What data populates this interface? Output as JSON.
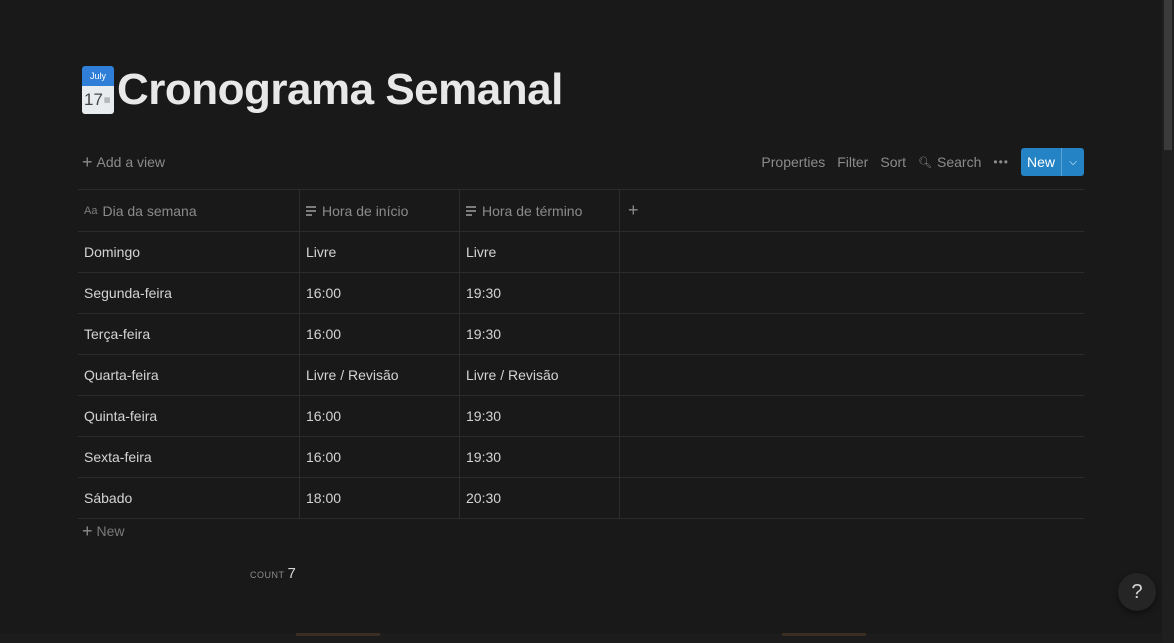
{
  "page": {
    "icon_month": "July",
    "icon_day": "17",
    "title": "Cronograma Semanal"
  },
  "toolbar": {
    "add_view": "Add a view",
    "properties": "Properties",
    "filter": "Filter",
    "sort": "Sort",
    "search": "Search",
    "new": "New"
  },
  "table": {
    "columns": [
      "Dia da semana",
      "Hora de início",
      "Hora de término"
    ],
    "rows": [
      [
        "Domingo",
        "Livre",
        "Livre"
      ],
      [
        "Segunda-feira",
        "16:00",
        "19:30"
      ],
      [
        "Terça-feira",
        "16:00",
        "19:30"
      ],
      [
        "Quarta-feira",
        "Livre / Revisão",
        "Livre / Revisão"
      ],
      [
        "Quinta-feira",
        "16:00",
        "19:30"
      ],
      [
        "Sexta-feira",
        "16:00",
        "19:30"
      ],
      [
        "Sábado",
        "18:00",
        "20:30"
      ]
    ],
    "new_row": "New",
    "count_label": "COUNT",
    "count_value": "7"
  },
  "help": {
    "label": "?"
  },
  "colors": {
    "accent": "#2383c4",
    "background": "#191919"
  }
}
